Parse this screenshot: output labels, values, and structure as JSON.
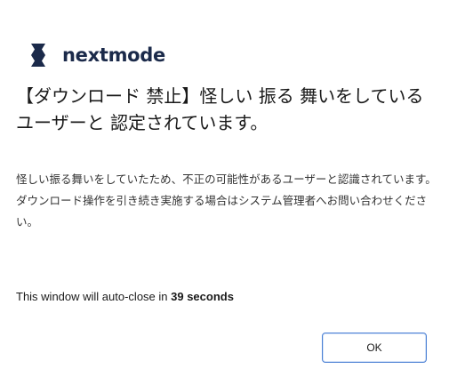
{
  "brand": {
    "name": "nextmode",
    "logo_icon": "nextmode-x-logo-icon",
    "color": "#1b2a4a"
  },
  "headline": {
    "line1": "【ダウンロード 禁止】怪しい 振る 舞いをしている",
    "line2": "ユーザーと 認定されています。"
  },
  "message": {
    "paragraph1": "怪しい振る舞いをしていたため、不正の可能性があるユーザーと認識されています。",
    "paragraph2": "ダウンロード操作を引き続き実施する場合はシステム管理者へお問い合わせください。"
  },
  "countdown": {
    "prefix": "This window will auto-close in ",
    "seconds_value": "39",
    "suffix": " seconds"
  },
  "buttons": {
    "ok_label": "OK"
  },
  "colors": {
    "button_border": "#4a7fd4",
    "text": "#1a1a1a"
  }
}
